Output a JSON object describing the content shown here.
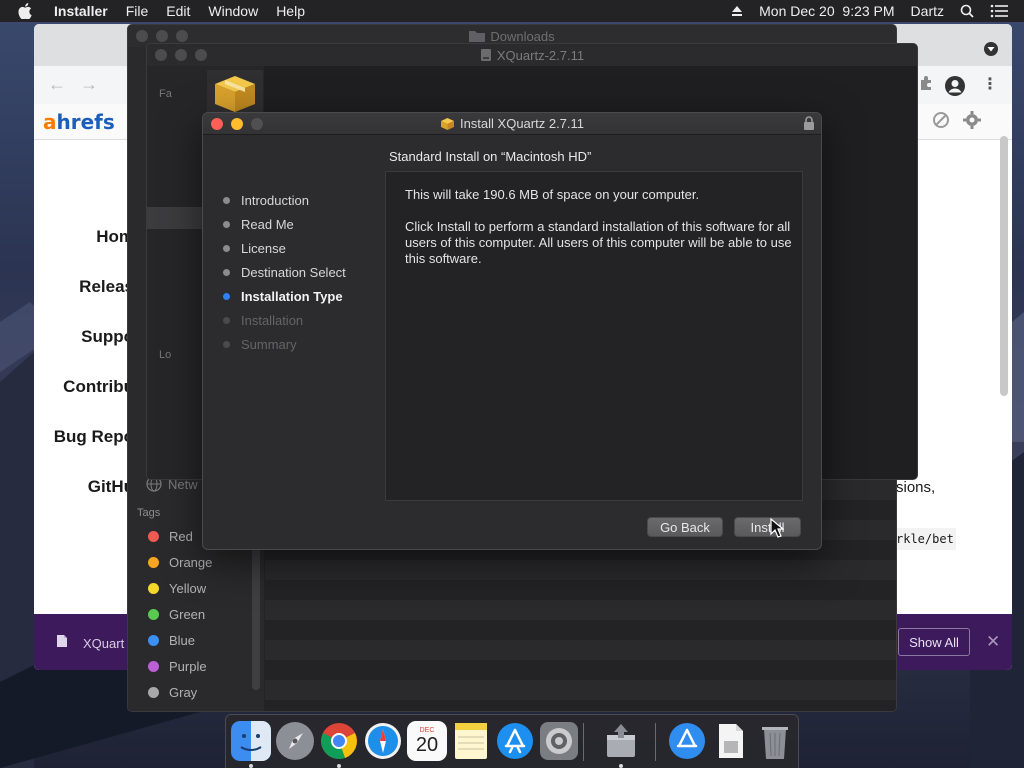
{
  "menubar": {
    "app_name": "Installer",
    "menus": [
      "File",
      "Edit",
      "Window",
      "Help"
    ],
    "clock": "Mon Dec 20  9:23 PM",
    "user": "Dartz",
    "icons": [
      "apple-icon",
      "eject-icon",
      "spotlight-search-icon",
      "notification-list-icon"
    ]
  },
  "browser": {
    "logo_a": "a",
    "logo_rest": "hrefs",
    "sidenav": [
      "Hom",
      "Releas",
      "Suppo",
      "Contribu",
      "Bug Repo",
      "GitHu"
    ],
    "content_text": "sions,",
    "code_text": "rkle/bet",
    "download_file": "XQuart",
    "show_all": "Show All",
    "close": "✕"
  },
  "finder_downloads": {
    "title": "Downloads",
    "tags_title": "Tags",
    "tags": [
      {
        "name": "Red",
        "color": "#f05a52"
      },
      {
        "name": "Orange",
        "color": "#f6a523"
      },
      {
        "name": "Yellow",
        "color": "#f5d929"
      },
      {
        "name": "Green",
        "color": "#57ca4f"
      },
      {
        "name": "Blue",
        "color": "#3b8ff5"
      },
      {
        "name": "Purple",
        "color": "#bd5fd6"
      },
      {
        "name": "Gray",
        "color": "#a8a8ab"
      }
    ],
    "network_label": "Netw"
  },
  "finder_xquartz": {
    "title": "XQuartz-2.7.11",
    "favorites_label": "Fa",
    "locations_label": "Lo"
  },
  "installer": {
    "title": "Install XQuartz 2.7.11",
    "heading": "Standard Install on “Macintosh HD”",
    "steps": [
      {
        "label": "Introduction",
        "state": "done"
      },
      {
        "label": "Read Me",
        "state": "done"
      },
      {
        "label": "License",
        "state": "done"
      },
      {
        "label": "Destination Select",
        "state": "done"
      },
      {
        "label": "Installation Type",
        "state": "current"
      },
      {
        "label": "Installation",
        "state": "pending"
      },
      {
        "label": "Summary",
        "state": "pending"
      }
    ],
    "space_text": "This will take 190.6 MB of space on your computer.",
    "body_text": "Click Install to perform a standard installation of this software for all users of this computer. All users of this computer will be able to use this software.",
    "go_back": "Go Back",
    "install": "Install"
  },
  "dock": {
    "apps": [
      "finder-icon",
      "launchpad-icon",
      "chrome-icon",
      "safari-icon",
      "calendar-icon",
      "notes-icon",
      "app-store-icon",
      "system-preferences-icon",
      "installer-icon",
      "applications-folder-icon",
      "downloads-stack-icon",
      "trash-icon"
    ],
    "calendar_month": "DEC",
    "calendar_day": "20"
  }
}
